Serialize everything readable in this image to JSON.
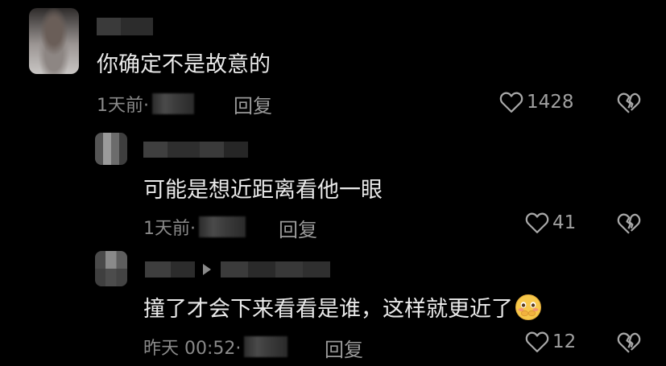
{
  "comments": [
    {
      "text": "你确定不是故意的",
      "time": "1天前·",
      "reply": "回复",
      "likes": "1428"
    },
    {
      "text": "可能是想近距离看他一眼",
      "time": "1天前·",
      "reply": "回复",
      "likes": "41"
    },
    {
      "text": "撞了才会下来看看是谁，这样就更近了",
      "time": "昨天 00:52·",
      "reply": "回复",
      "likes": "12"
    }
  ],
  "colors": {
    "background": "#000000",
    "text": "#e9e9e9",
    "meta": "#8a8a8a"
  },
  "icons": [
    "heart-icon",
    "broken-heart-icon",
    "blush-emoji-icon",
    "reply-arrow-icon"
  ]
}
